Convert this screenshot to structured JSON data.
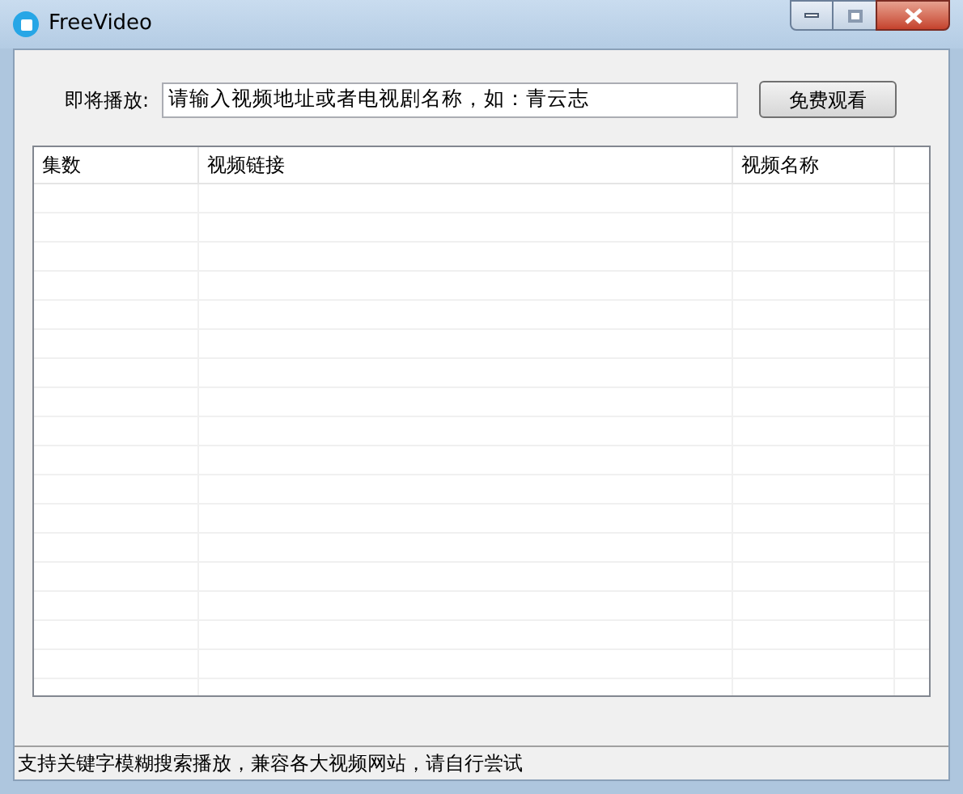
{
  "window": {
    "title": "FreeVideo"
  },
  "toolbar": {
    "label": "即将播放:",
    "input": {
      "value": "请输入视频地址或者电视剧名称，如：青云志"
    },
    "button": "免费观看"
  },
  "table": {
    "columns": [
      "集数",
      "视频链接",
      "视频名称"
    ]
  },
  "status_bar": "支持关键字模糊搜索播放，兼容各大视频网站，请自行尝试"
}
